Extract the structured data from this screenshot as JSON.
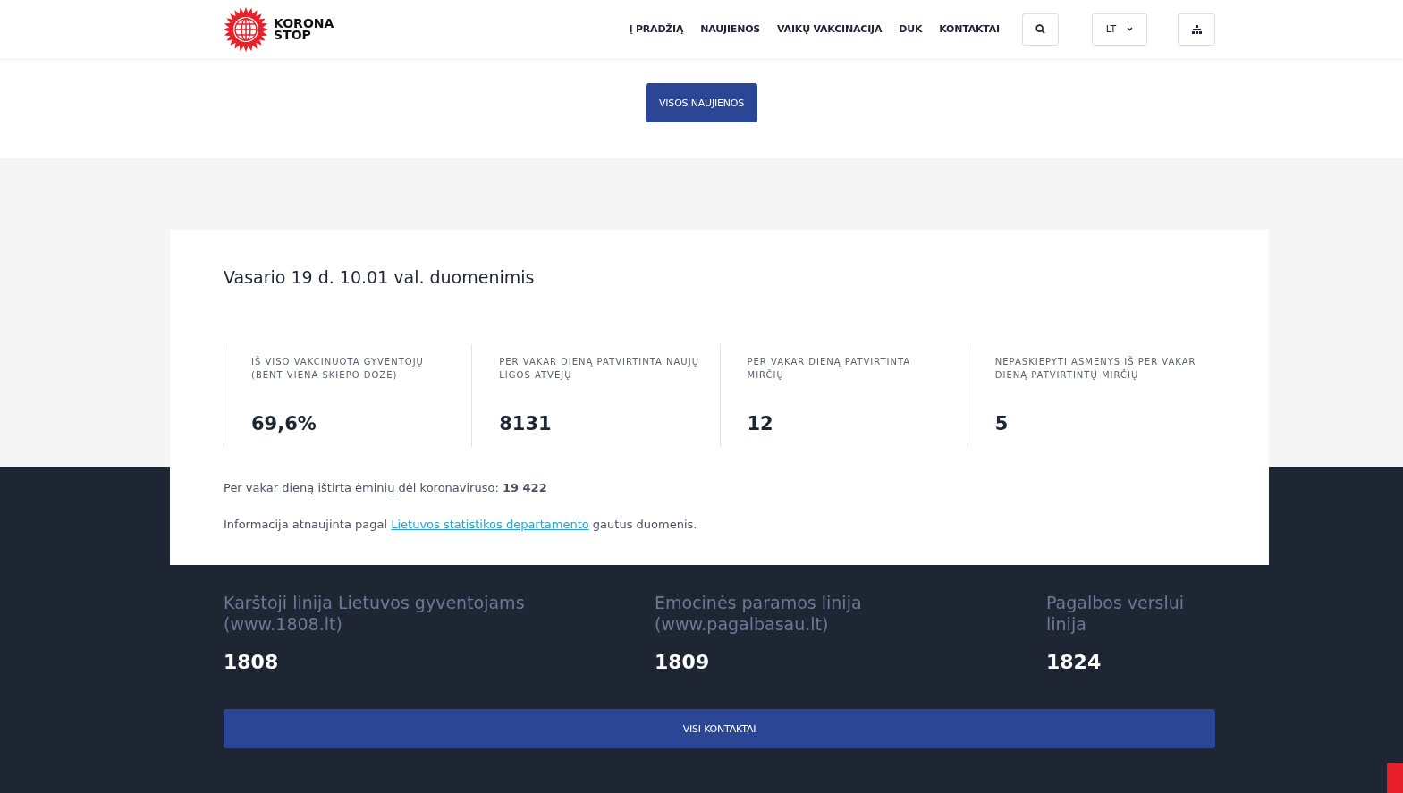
{
  "header": {
    "logo": {
      "line1": "KORONA",
      "line2": "STOP"
    },
    "nav": [
      "Į PRADŽIĄ",
      "NAUJIENOS",
      "VAIKŲ VAKCINACIJA",
      "DUK",
      "KONTAKTAI"
    ],
    "language": "LT"
  },
  "news": {
    "button": "VISOS NAUJIENOS"
  },
  "stats": {
    "title": "Vasario 19 d. 10.01 val. duomenimis",
    "items": [
      {
        "label": "IŠ VISO VAKCINUOTA GYVENTOJŲ (BENT VIENA SKIEPO DOZE)",
        "value": "69,6%"
      },
      {
        "label": "PER VAKAR DIENĄ PATVIRTINTA NAUJŲ LIGOS ATVEJŲ",
        "value": "8131"
      },
      {
        "label": "PER VAKAR DIENĄ PATVIRTINTA MIRČIŲ",
        "value": "12"
      },
      {
        "label": "NEPASKIEPYTI ASMENYS IŠ PER VAKAR DIENĄ PATVIRTINTŲ MIRČIŲ",
        "value": "5"
      }
    ],
    "tests": "Per vakar dieną ištirta ėminių dėl koronaviruso: **19 422**",
    "source": {
      "before": "Informacija atnaujinta pagal",
      "link": "Lietuvos statistikos departamento",
      "after": "gautus duomenis."
    }
  },
  "contacts": {
    "lines": [
      {
        "title": "Karštoji linija Lietuvos gyventojams (www.1808.lt)",
        "number": "1808"
      },
      {
        "title": "Emocinės paramos linija (www.pagalbasau.lt)",
        "number": "1809"
      },
      {
        "title": "Pagalbos verslui linija",
        "number": "1824"
      }
    ],
    "button": "VISI KONTAKTAI"
  }
}
